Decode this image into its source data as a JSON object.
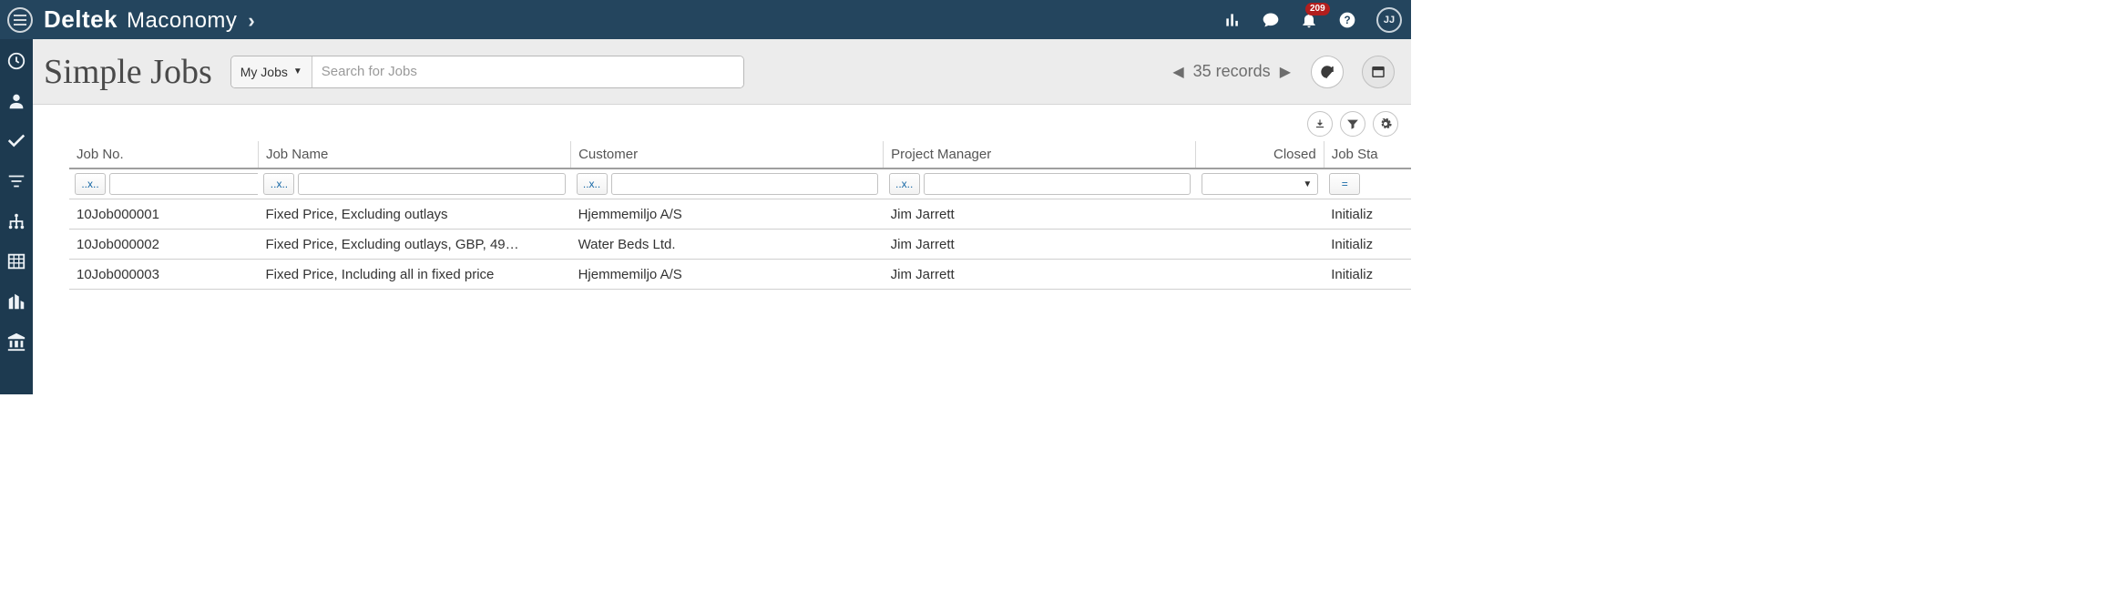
{
  "brand": {
    "primary": "Deltek",
    "secondary": "Maconomy",
    "caret": "›"
  },
  "topbar": {
    "notification_count": "209",
    "avatar_initials": "JJ"
  },
  "header": {
    "title": "Simple Jobs",
    "search_scope": "My Jobs",
    "search_placeholder": "Search for Jobs",
    "record_count": "35 records"
  },
  "filters": {
    "contains_op": "..x..",
    "equals_op": "="
  },
  "columns": {
    "jobno": "Job No.",
    "jobname": "Job Name",
    "customer": "Customer",
    "pm": "Project Manager",
    "closed": "Closed",
    "status": "Job Sta"
  },
  "rows": [
    {
      "jobno": "10Job000001",
      "jobname": "Fixed Price, Excluding outlays",
      "customer": "Hjemmemiljo A/S",
      "pm": "Jim Jarrett",
      "closed": "",
      "status": "Initializ"
    },
    {
      "jobno": "10Job000002",
      "jobname": "Fixed Price, Excluding outlays, GBP, 49…",
      "customer": "Water Beds Ltd.",
      "pm": "Jim Jarrett",
      "closed": "",
      "status": "Initializ"
    },
    {
      "jobno": "10Job000003",
      "jobname": "Fixed Price, Including all in fixed price",
      "customer": "Hjemmemiljo A/S",
      "pm": "Jim Jarrett",
      "closed": "",
      "status": "Initializ"
    }
  ]
}
